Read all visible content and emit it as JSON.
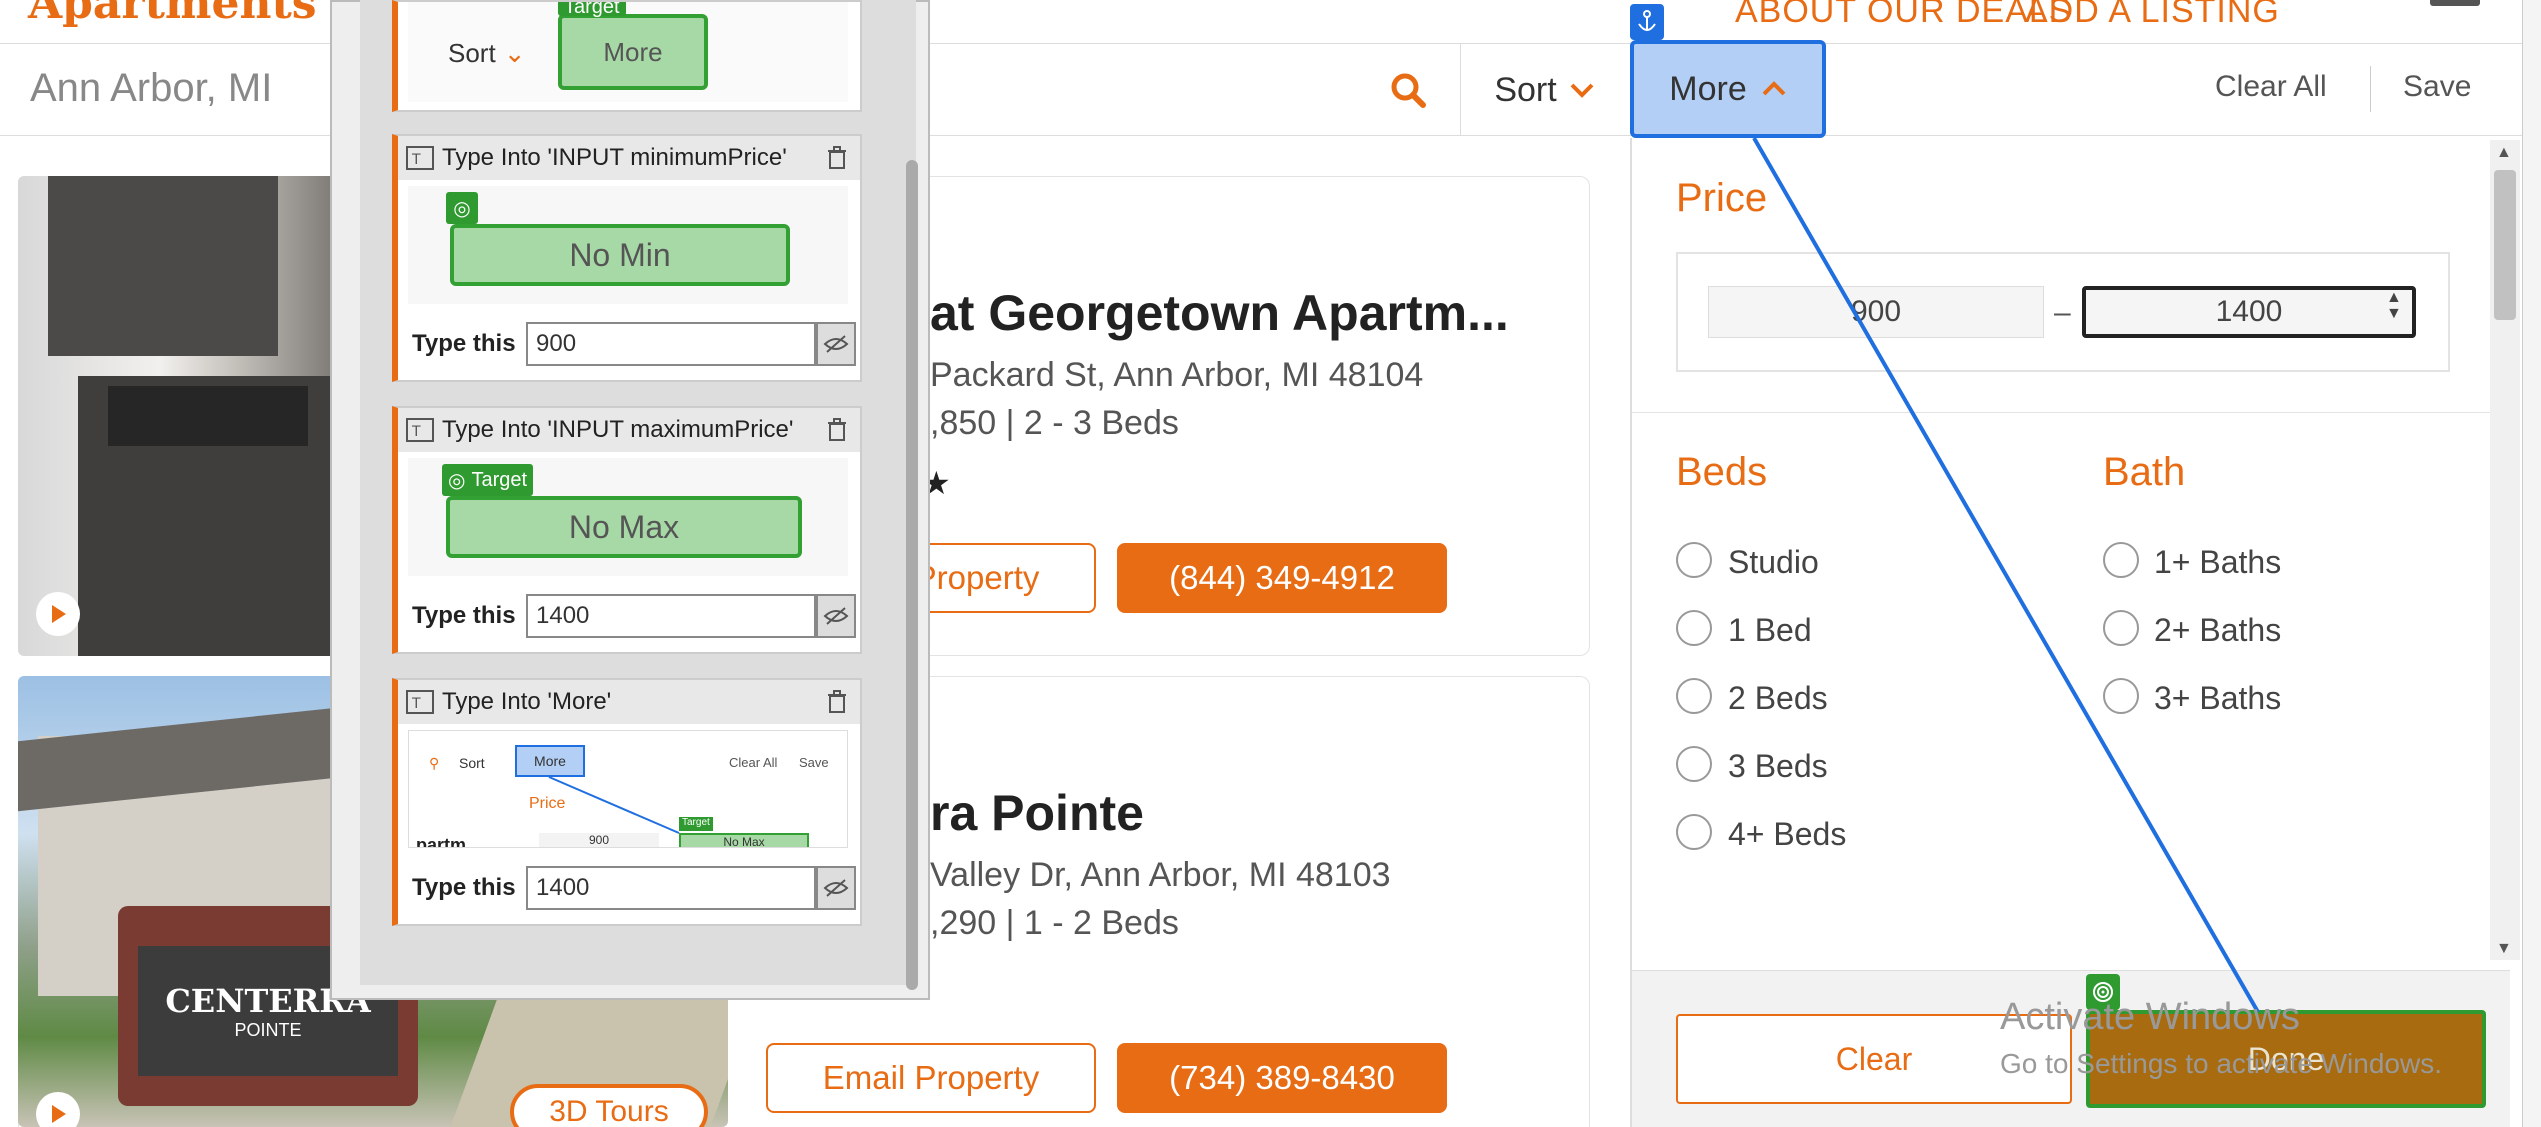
{
  "nav": {
    "logo": "Apartments",
    "links": [
      "ABOUT OUR DEALS",
      "ADD A LISTING"
    ]
  },
  "search": {
    "value": "Ann Arbor, MI",
    "sort_label": "Sort",
    "more_label": "More",
    "clear_all": "Clear All",
    "save": "Save"
  },
  "listings": [
    {
      "title": "at Georgetown Apartm...",
      "address": "Packard St, Ann Arbor, MI 48104",
      "price": ",850 | 2 - 3 Beds",
      "email_btn": "Property",
      "phone": "(844) 349-4912"
    },
    {
      "title": "ra Pointe",
      "address": "Valley Dr, Ann Arbor, MI 48103",
      "price": ",290 | 1 - 2 Beds",
      "email_btn": "Email Property",
      "phone": "(734) 389-8430",
      "tours": "3D Tours",
      "sign": "CENTERRA",
      "sign_sub": "POINTE"
    }
  ],
  "filter": {
    "price_heading": "Price",
    "min": "900",
    "max": "1400",
    "dash": "–",
    "beds_heading": "Beds",
    "beds": [
      "Studio",
      "1 Bed",
      "2 Beds",
      "3 Beds",
      "4+ Beds"
    ],
    "bath_heading": "Bath",
    "baths": [
      "1+ Baths",
      "2+ Baths",
      "3+ Baths"
    ],
    "clear": "Clear",
    "done": "Done"
  },
  "watermark": {
    "line1": "Activate Windows",
    "line2": "Go to Settings to activate Windows."
  },
  "studio": {
    "steps": [
      {
        "title": "Type Into 'INPUT minimumPrice'",
        "type_label": "Type this",
        "value": "900",
        "preview": "No Min"
      },
      {
        "title": "Type Into 'INPUT maximumPrice'",
        "type_label": "Type this",
        "value": "1400",
        "preview": "No Max",
        "badge": "Target"
      },
      {
        "title": "Type Into 'More'",
        "type_label": "Type this",
        "value": "1400"
      }
    ],
    "top_preview": {
      "sort": "Sort",
      "more": "More",
      "badge": "Target"
    },
    "mini": {
      "sort": "Sort",
      "more": "More",
      "clear_all": "Clear All",
      "save": "Save",
      "price": "Price",
      "min": "900",
      "max": "No Max",
      "partial": ".partm...",
      "badge": "Target"
    }
  },
  "colors": {
    "accent": "#e86c14",
    "selection": "#1f6fe0",
    "target": "#2f9a2f"
  }
}
